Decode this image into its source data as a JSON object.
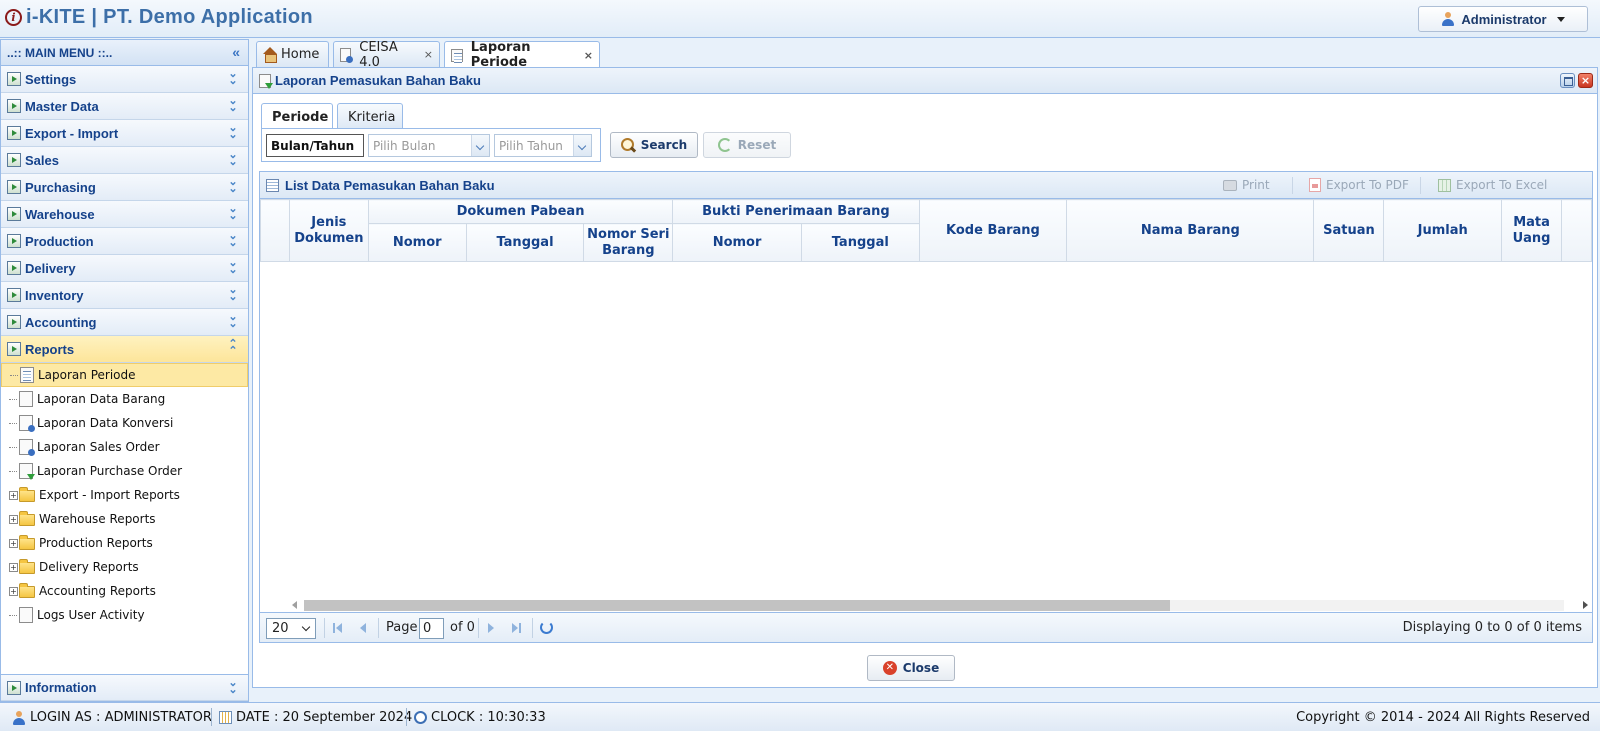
{
  "header": {
    "title": "i-KITE | PT. Demo Application",
    "logo_letter": "i",
    "user_button": "Administrator"
  },
  "sidebar": {
    "title": "..:: MAIN MENU ::..",
    "collapse_glyph": "«",
    "sections": [
      {
        "label": "Settings"
      },
      {
        "label": "Master Data"
      },
      {
        "label": "Export - Import"
      },
      {
        "label": "Sales"
      },
      {
        "label": "Purchasing"
      },
      {
        "label": "Warehouse"
      },
      {
        "label": "Production"
      },
      {
        "label": "Delivery"
      },
      {
        "label": "Inventory"
      },
      {
        "label": "Accounting"
      },
      {
        "label": "Reports"
      }
    ],
    "reports_items": [
      {
        "label": "Laporan Periode"
      },
      {
        "label": "Laporan Data Barang"
      },
      {
        "label": "Laporan Data Konversi"
      },
      {
        "label": "Laporan Sales Order"
      },
      {
        "label": "Laporan Purchase Order"
      },
      {
        "label": "Export - Import Reports"
      },
      {
        "label": "Warehouse Reports"
      },
      {
        "label": "Production Reports"
      },
      {
        "label": "Delivery Reports"
      },
      {
        "label": "Accounting Reports"
      },
      {
        "label": "Logs User Activity"
      }
    ],
    "information": "Information"
  },
  "tabs": [
    {
      "label": "Home"
    },
    {
      "label": "CEISA 4.0",
      "close": "×"
    },
    {
      "label": "Laporan Periode",
      "close": "×"
    }
  ],
  "panel": {
    "title": "Laporan Pemasukan Bahan Baku",
    "close_glyph": "×",
    "filter_tabs": [
      {
        "label": "Periode"
      },
      {
        "label": "Kriteria"
      }
    ],
    "filter": {
      "mode": "Bulan/Tahun",
      "month_placeholder": "Pilih Bulan",
      "year_placeholder": "Pilih Tahun",
      "search_label": "Search",
      "reset_label": "Reset"
    },
    "grid": {
      "title": "List Data Pemasukan Bahan Baku",
      "print_label": "Print",
      "pdf_label": "Export To PDF",
      "excel_label": "Export To Excel",
      "columns": {
        "jenis_dokumen": "Jenis Dokumen",
        "dokumen_pabean": "Dokumen Pabean",
        "nomor": "Nomor",
        "tanggal": "Tanggal",
        "nomor_seri_barang": "Nomor Seri Barang",
        "bukti_penerimaan": "Bukti Penerimaan Barang",
        "bukti_nomor": "Nomor",
        "bukti_tanggal": "Tanggal",
        "kode_barang": "Kode Barang",
        "nama_barang": "Nama Barang",
        "satuan": "Satuan",
        "jumlah": "Jumlah",
        "mata_uang": "Mata Uang"
      },
      "pager": {
        "page_size": "20",
        "page_label": "Page",
        "page_value": "0",
        "of_label": "of 0",
        "display": "Displaying 0 to 0 of 0 items"
      }
    },
    "close_button": "Close"
  },
  "status": {
    "login": "LOGIN AS : ADMINISTRATOR",
    "date": "DATE : 20 September 2024",
    "clock": "CLOCK : 10:30:33",
    "copyright": "Copyright © 2014 - 2024 All Rights Reserved"
  }
}
